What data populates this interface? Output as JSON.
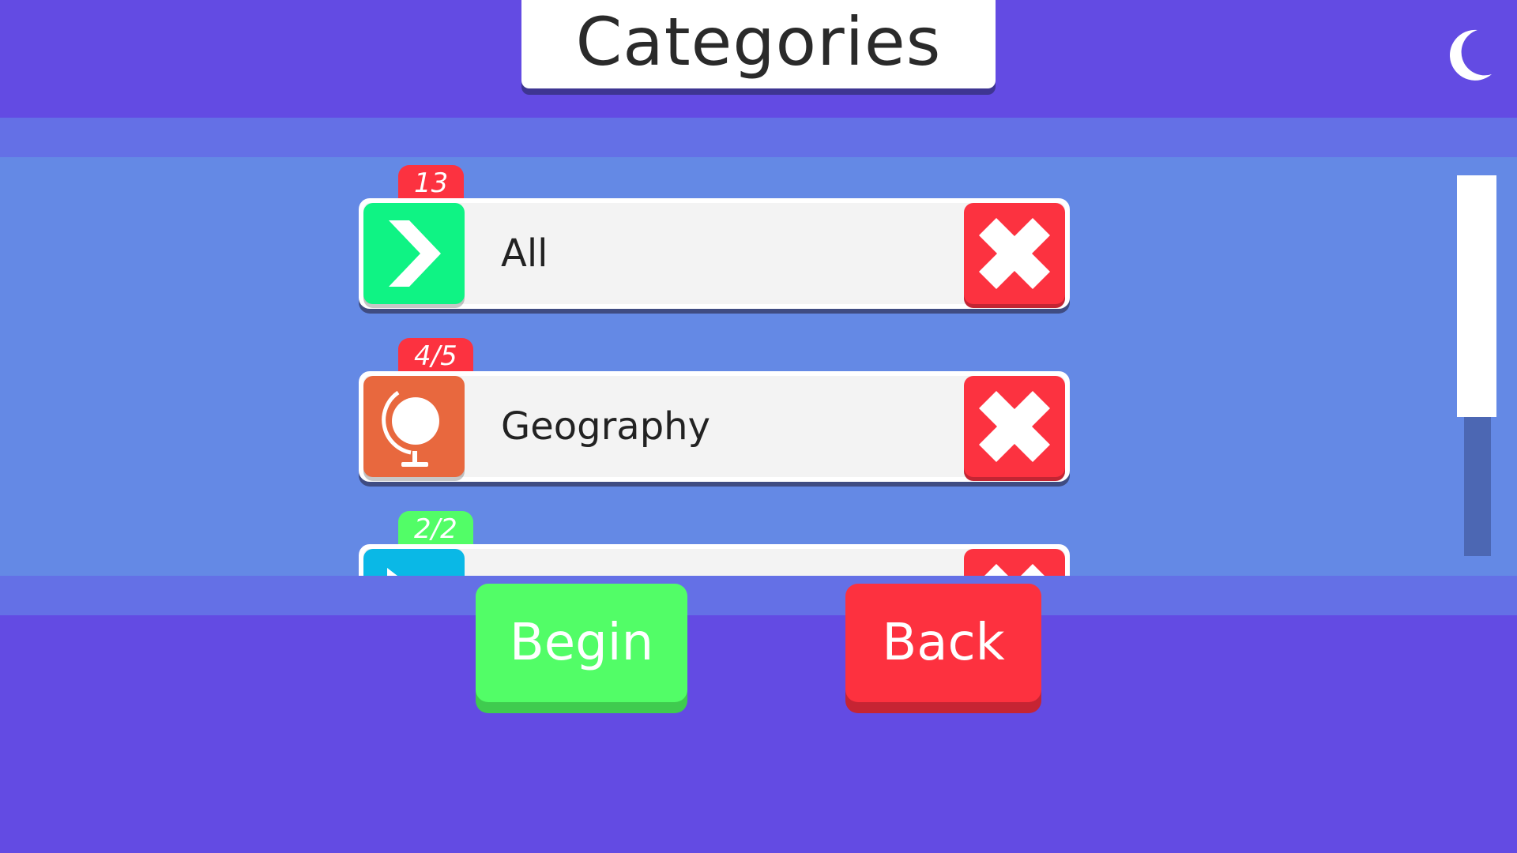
{
  "header": {
    "title": "Categories",
    "theme_toggle_icon": "crescent-moon-icon"
  },
  "categories": [
    {
      "count": "13",
      "badge_color": "#fc3240",
      "label": "All",
      "icon": "chevron-right-icon",
      "icon_color": "#0ff384"
    },
    {
      "count": "4/5",
      "badge_color": "#fc3240",
      "label": "Geography",
      "icon": "globe-icon",
      "icon_color": "#e8683e"
    },
    {
      "count": "2/2",
      "badge_color": "#52fd67",
      "label": "",
      "icon": "play-icon",
      "icon_color": "#0ab8e6"
    }
  ],
  "remove_icon": "close-icon",
  "actions": {
    "begin_label": "Begin",
    "back_label": "Back"
  },
  "colors": {
    "background": "#634be3",
    "list_background": "#6489e5",
    "band": "#6470e6",
    "begin": "#52fd67",
    "back": "#fd313f"
  }
}
